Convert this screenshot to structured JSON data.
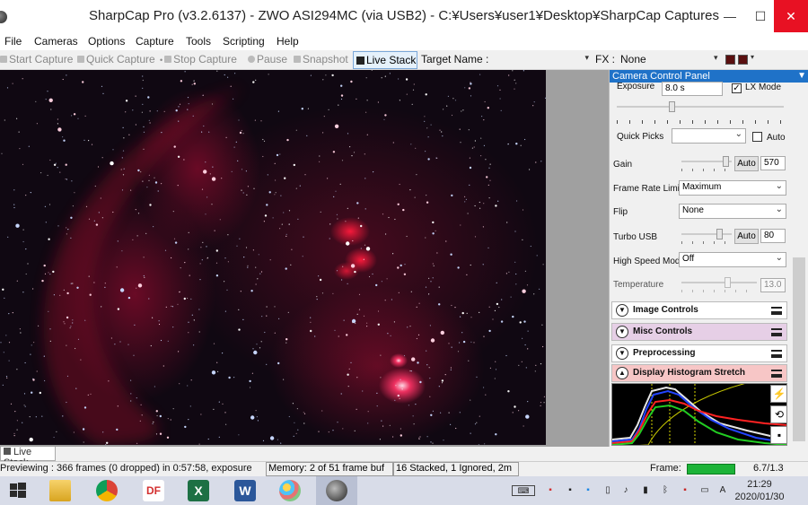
{
  "window": {
    "title": "SharpCap Pro (v3.2.6137) - ZWO ASI294MC (via USB2) - C:¥Users¥user1¥Desktop¥SharpCap Captures",
    "minimize": "—",
    "maximize": "☐",
    "close": "✕"
  },
  "menu": [
    "File",
    "Cameras",
    "Options",
    "Capture",
    "Tools",
    "Scripting",
    "Help"
  ],
  "toolbar": {
    "start_capture": "Start Capture",
    "quick_capture": "Quick Capture",
    "stop_capture": "Stop Capture",
    "pause": "Pause",
    "snapshot": "Snapshot",
    "live_stack": "Live Stack",
    "target_label": "Target Name :",
    "target_value": "",
    "fx_label": "FX :",
    "fx_value": "None"
  },
  "panel": {
    "title": "Camera Control Panel",
    "exposure_label": "Exposure",
    "exposure_value": "8.0 s",
    "lx_mode_label": "LX Mode",
    "lx_mode_checked": true,
    "quick_picks_label": "Quick Picks",
    "quick_picks_value": "",
    "auto_label": "Auto",
    "gain_label": "Gain",
    "gain_auto": "Auto",
    "gain_value": "570",
    "gain_level": 0.93,
    "frame_rate_label": "Frame Rate Limit",
    "frame_rate_value": "Maximum",
    "flip_label": "Flip",
    "flip_value": "None",
    "turbo_label": "Turbo USB",
    "turbo_auto": "Auto",
    "turbo_value": "80",
    "turbo_level": 0.8,
    "high_speed_label": "High Speed Mode",
    "high_speed_value": "Off",
    "temperature_label": "Temperature",
    "temperature_value": "13.0",
    "sections": [
      {
        "label": "Image Controls",
        "color": "#ffffff"
      },
      {
        "label": "Misc Controls",
        "color": "#e6cfe6"
      },
      {
        "label": "Preprocessing",
        "color": "#ffffff"
      },
      {
        "label": "Display Histogram Stretch",
        "color": "#f7c6c6"
      }
    ]
  },
  "live_stack_tab": "Live Stack",
  "status": {
    "previewing": "Previewing : 366 frames (0 dropped) in 0:57:58, exposure",
    "memory": "Memory: 2 of 51 frame buf",
    "stacked": "16 Stacked, 1 Ignored, 2m",
    "frame_label": "Frame:",
    "frame_ratio": "6.7/1.3",
    "frame_level": 0.99
  },
  "taskbar": {
    "apps": [
      "start-icon",
      "file-explorer-icon",
      "chrome-icon",
      "pdf-app-icon",
      "excel-icon",
      "word-icon",
      "paint-icon",
      "sharpcap-icon"
    ],
    "time": "21:29",
    "date": "2020/01/30",
    "ime": "A"
  },
  "colors": {
    "panel_header": "#1f72c8",
    "frame_bar": "#1cb338",
    "close_button": "#e81123"
  }
}
